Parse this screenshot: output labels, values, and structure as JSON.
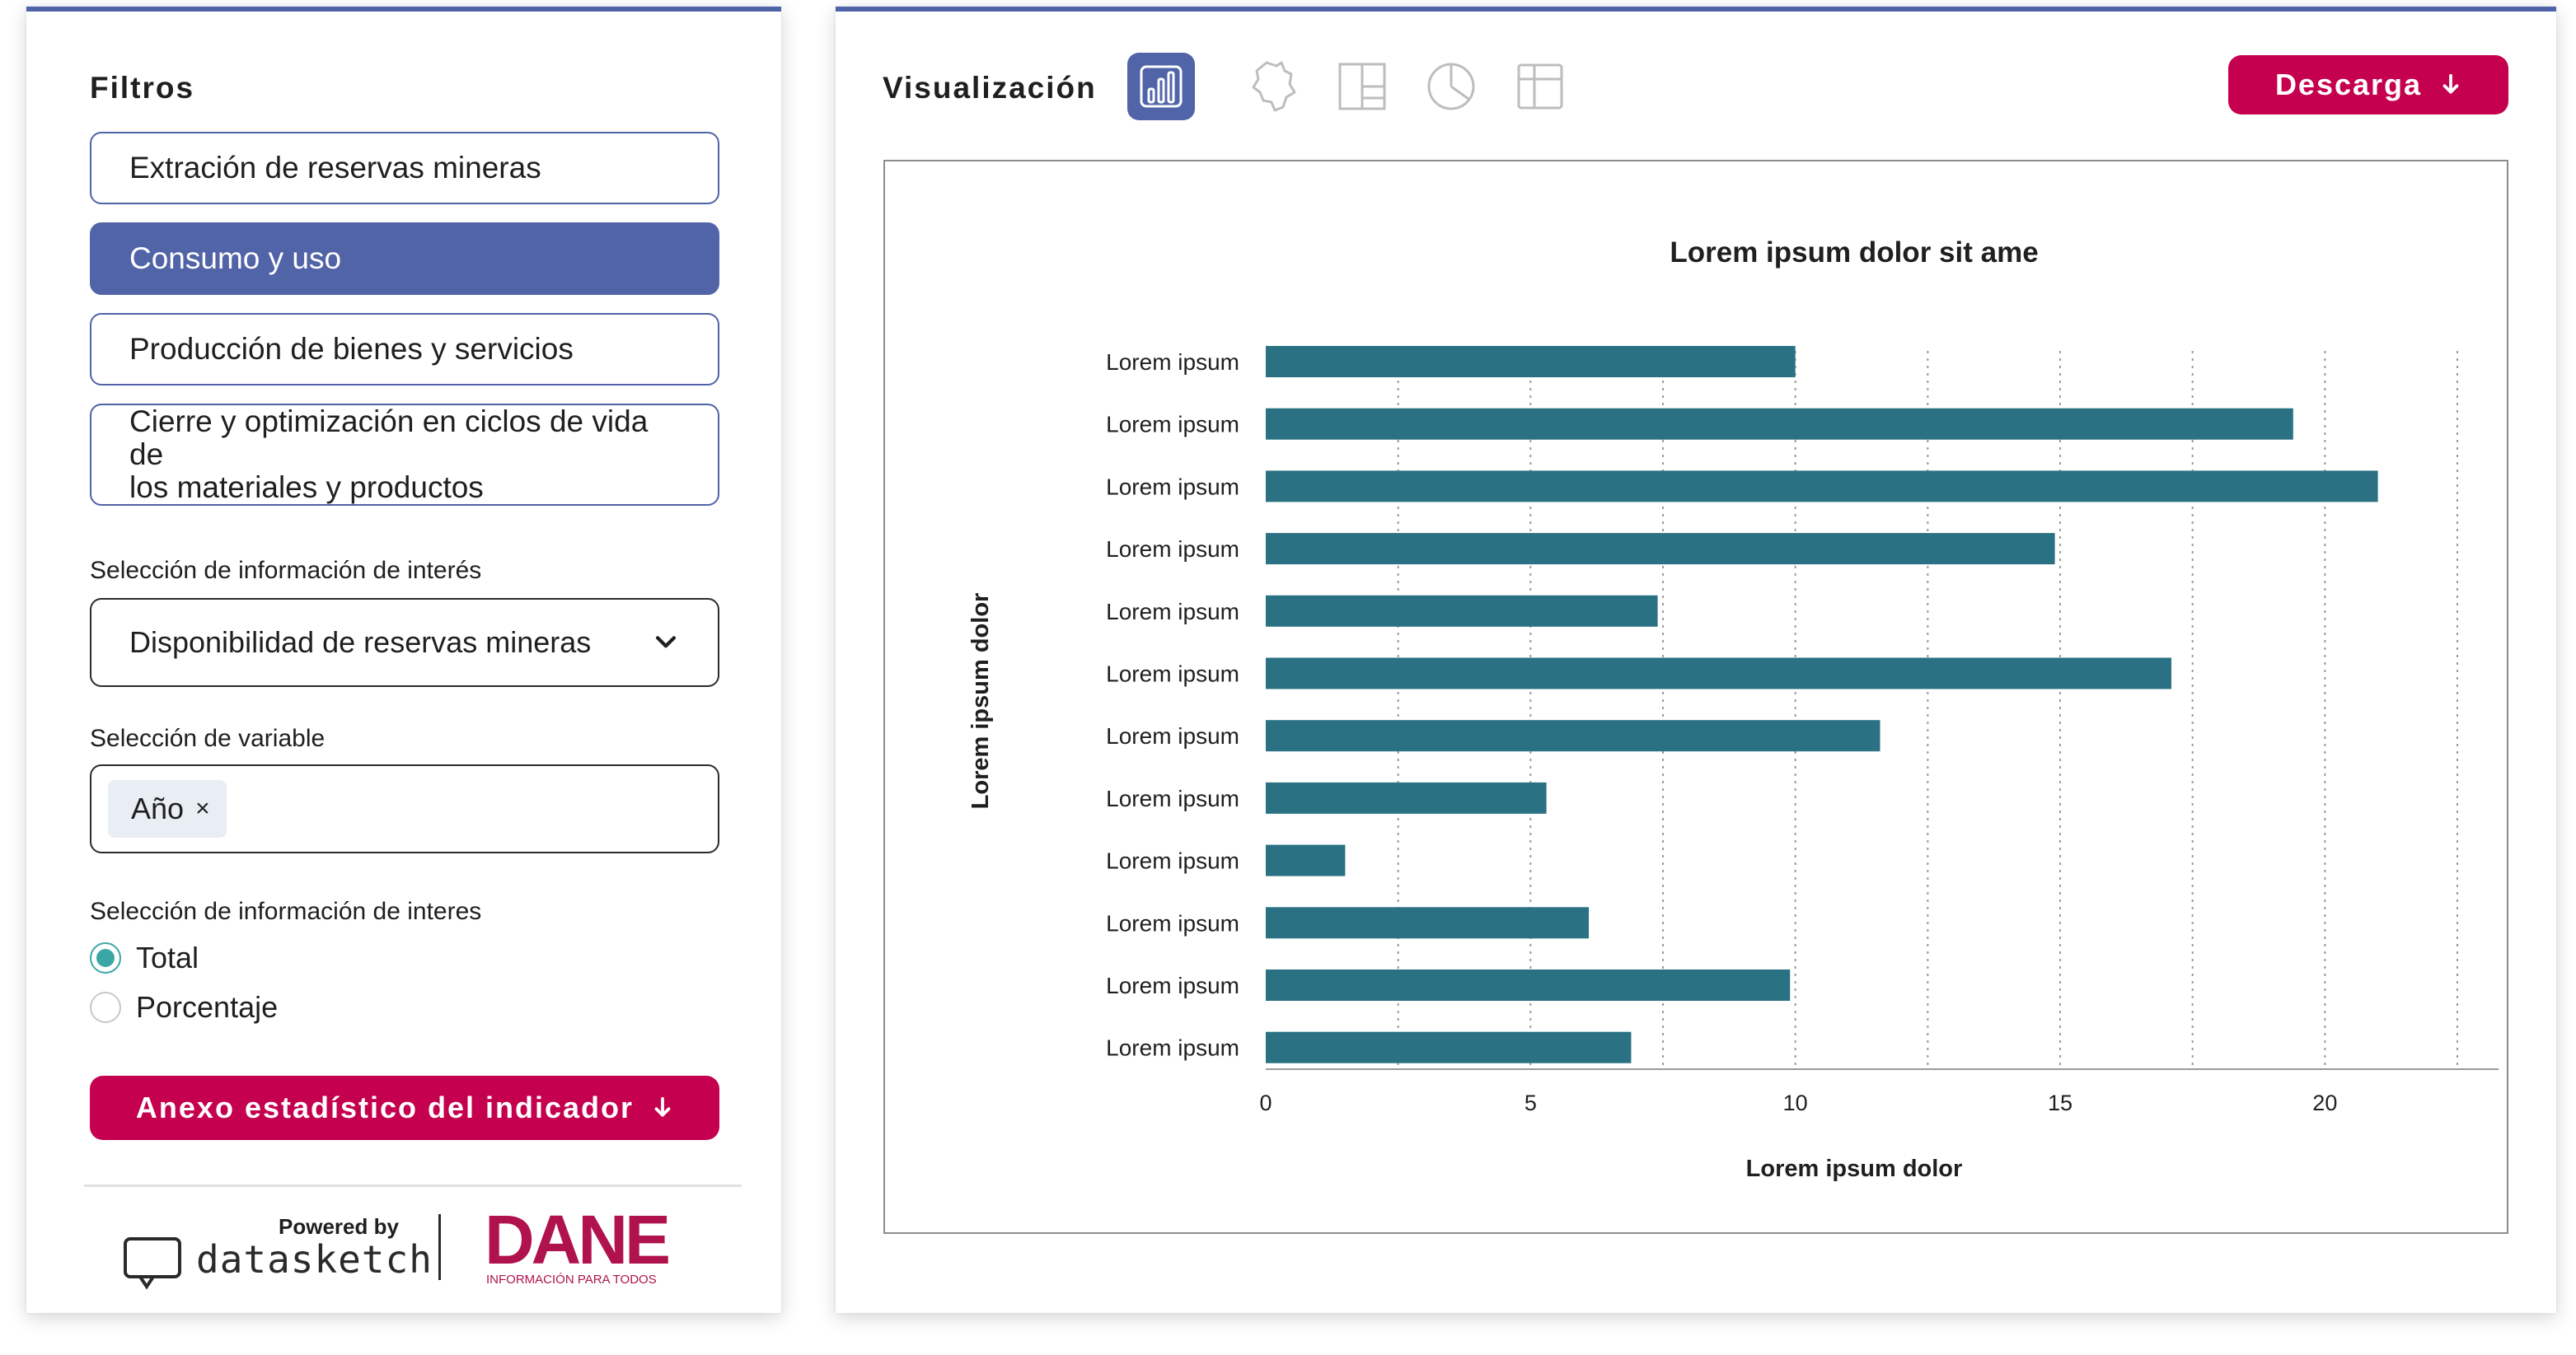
{
  "filters": {
    "title": "Filtros",
    "options": [
      {
        "label_lines": [
          "Extración de reservas mineras"
        ],
        "active": false
      },
      {
        "label_lines": [
          "Consumo y uso"
        ],
        "active": true
      },
      {
        "label_lines": [
          "Producción de bienes y servicios"
        ],
        "active": false
      },
      {
        "label_lines": [
          "Cierre y optimización en ciclos de vida de",
          "los materiales y productos"
        ],
        "active": false
      }
    ]
  },
  "info_selection": {
    "label": "Selección de información de interés",
    "selected_value": "Disponibilidad de reservas mineras"
  },
  "variable_selection": {
    "label": "Selección de variable",
    "tags": [
      "Año"
    ]
  },
  "info_type": {
    "label": "Selección de información de interes",
    "options": [
      {
        "label": "Total",
        "checked": true
      },
      {
        "label": "Porcentaje",
        "checked": false
      }
    ]
  },
  "annex_button": {
    "label": "Anexo estadístico del indicador"
  },
  "footer": {
    "powered_by": "Powered by",
    "datasketch": "datasketch",
    "dane": "DANE",
    "dane_tagline": "INFORMACIÓN PARA TODOS"
  },
  "visualization": {
    "title": "Visualización",
    "view_icons": [
      {
        "name": "bar-chart-icon",
        "active": true
      },
      {
        "name": "map-icon",
        "active": false
      },
      {
        "name": "treemap-icon",
        "active": false
      },
      {
        "name": "pie-chart-icon",
        "active": false
      },
      {
        "name": "table-icon",
        "active": false
      }
    ],
    "download_label": "Descarga"
  },
  "colors": {
    "accent": "#5264a8",
    "cta": "#c4004f",
    "bar": "#2a7183",
    "radio": "#3aa7a6"
  },
  "chart_data": {
    "type": "bar",
    "orientation": "horizontal",
    "title": "Lorem ipsum dolor sit ame",
    "xlabel": "Lorem ipsum dolor",
    "ylabel": "Lorem ipsum dolor",
    "categories": [
      "Lorem ipsum",
      "Lorem ipsum",
      "Lorem ipsum",
      "Lorem ipsum",
      "Lorem ipsum",
      "Lorem ipsum",
      "Lorem ipsum",
      "Lorem ipsum",
      "Lorem ipsum",
      "Lorem ipsum",
      "Lorem ipsum",
      "Lorem ipsum"
    ],
    "values": [
      10.0,
      19.4,
      21.0,
      14.9,
      7.4,
      17.1,
      11.6,
      5.3,
      1.5,
      6.1,
      9.9,
      6.9
    ],
    "xlim": [
      0,
      22.5
    ],
    "xticks": [
      0,
      5,
      10,
      15,
      20
    ],
    "gridlines": [
      2.5,
      5,
      7.5,
      10,
      12.5,
      15,
      17.5,
      20,
      22.5
    ],
    "grid": true
  }
}
